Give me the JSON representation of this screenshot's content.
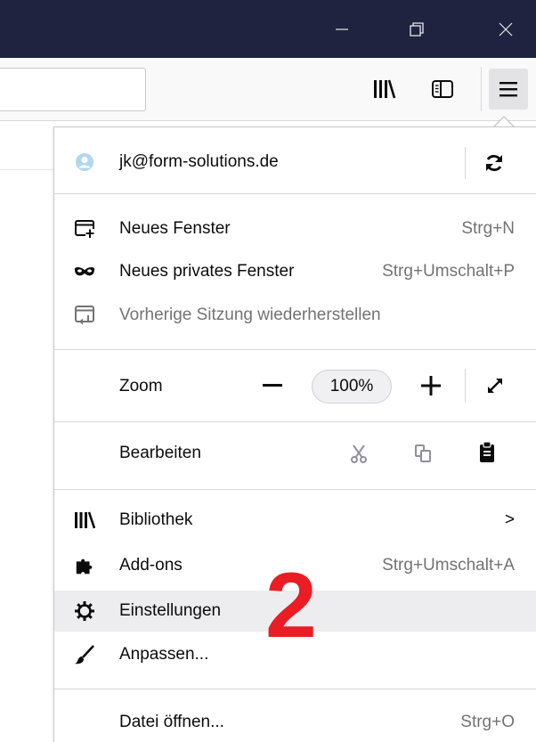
{
  "window": {
    "minimize_icon": "minimize-icon",
    "restore_icon": "restore-icon",
    "close_icon": "close-icon"
  },
  "toolbar": {
    "library_icon": "library-icon",
    "sidebar_icon": "sidebar-icon",
    "menu_icon": "hamburger-menu-icon"
  },
  "menu": {
    "account": {
      "email": "jk@form-solutions.de",
      "sync_icon": "sync-icon"
    },
    "items": [
      {
        "label": "Neues Fenster",
        "shortcut": "Strg+N",
        "icon": "new-window-icon"
      },
      {
        "label": "Neues privates Fenster",
        "shortcut": "Strg+Umschalt+P",
        "icon": "private-mask-icon"
      },
      {
        "label": "Vorherige Sitzung wiederherstellen",
        "shortcut": "",
        "icon": "restore-session-icon",
        "disabled": true
      }
    ],
    "zoom": {
      "label": "Zoom",
      "minus": "—",
      "value": "100%",
      "plus": "+",
      "fullscreen_icon": "fullscreen-icon"
    },
    "edit": {
      "label": "Bearbeiten",
      "cut_icon": "cut-icon",
      "copy_icon": "copy-icon",
      "paste_icon": "paste-icon"
    },
    "items2": [
      {
        "label": "Bibliothek",
        "shortcut": ">",
        "icon": "library-icon"
      },
      {
        "label": "Add-ons",
        "shortcut": "Strg+Umschalt+A",
        "icon": "puzzle-icon"
      },
      {
        "label": "Einstellungen",
        "shortcut": "",
        "icon": "gear-icon",
        "highlighted": true
      },
      {
        "label": "Anpassen...",
        "shortcut": "",
        "icon": "paintbrush-icon"
      }
    ],
    "file": {
      "label": "Datei öffnen...",
      "shortcut": "Strg+O"
    }
  },
  "annotation": {
    "text": "2",
    "color": "#ea1c24"
  }
}
